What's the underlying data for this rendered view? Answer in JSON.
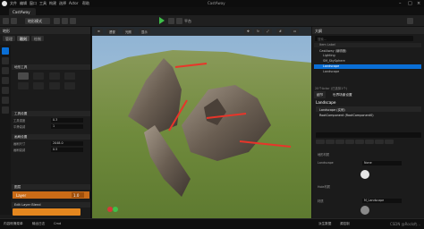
{
  "app": {
    "title": "CastAway",
    "menu": [
      "文件",
      "编辑",
      "窗口",
      "工具",
      "构建",
      "选择",
      "Actor",
      "帮助"
    ],
    "tab_label": "CastAway"
  },
  "toolbar": {
    "mode_label": "地形模式",
    "platforms_label": "平台"
  },
  "left_panel": {
    "title": "地形",
    "mode_tabs": [
      "管理",
      "雕刻",
      "绘制"
    ],
    "sections": [
      {
        "label": "地形工具"
      },
      {
        "label": "工具设置"
      },
      {
        "label": "画刷设置"
      },
      {
        "label": "图层"
      },
      {
        "label": "Edit Layer Blend"
      }
    ],
    "props": [
      {
        "label": "工具强度",
        "value": "0.3"
      },
      {
        "label": "平滑衰减",
        "value": "1"
      },
      {
        "label": "画刷尺寸",
        "value": "2048.0"
      },
      {
        "label": "画刷衰减",
        "value": "0.5"
      }
    ],
    "layer_name": "Layer",
    "layer_value": "1.0",
    "bottom_label": "内容侧滑菜单"
  },
  "viewport": {
    "buttons": [
      "透视",
      "光照",
      "显示"
    ],
    "colors": {
      "sky": "#7fa6c8",
      "grass": "#6f8a3c",
      "rock": "#6a5e52",
      "arrow": "#e8352a"
    }
  },
  "right_panel": {
    "outliner_title": "大纲",
    "search_placeholder": "搜索...",
    "column_label": "Item Label",
    "outliner_items": [
      {
        "label": "CastAway (编辑器)",
        "selected": false
      },
      {
        "label": "Lighting",
        "selected": false
      },
      {
        "label": "SM_SkySphere",
        "selected": false
      },
      {
        "label": "Landscape",
        "selected": true
      },
      {
        "label": "Landscape",
        "selected": false
      }
    ],
    "actor_count": "20个Actor (已选择1个)",
    "details_tabs": [
      "细节",
      "世界场景设置"
    ],
    "landscape_title": "Landscape",
    "components": [
      {
        "label": "Landscape (实例)"
      },
      {
        "label": "RootComponent (RootComponent0)"
      }
    ],
    "filters": [
      "通用",
      "Actor",
      "LOD",
      "杂项",
      "物理",
      "渲染",
      "流送",
      "全部"
    ],
    "detail_rows": [
      {
        "label": "地形材质",
        "value": ""
      },
      {
        "label": "Landscape",
        "value": "None"
      },
      {
        "label": "Hole材质",
        "value": ""
      },
      {
        "label": "材质",
        "value": "M_Landscape"
      }
    ]
  },
  "statusbar": {
    "content_drawer": "内容侧滑菜单",
    "output_log": "输出日志",
    "cmd": "Cmd",
    "source_control": "源控制",
    "derived_data": "派生数据",
    "watermark": "CSDN @Rock的..."
  }
}
